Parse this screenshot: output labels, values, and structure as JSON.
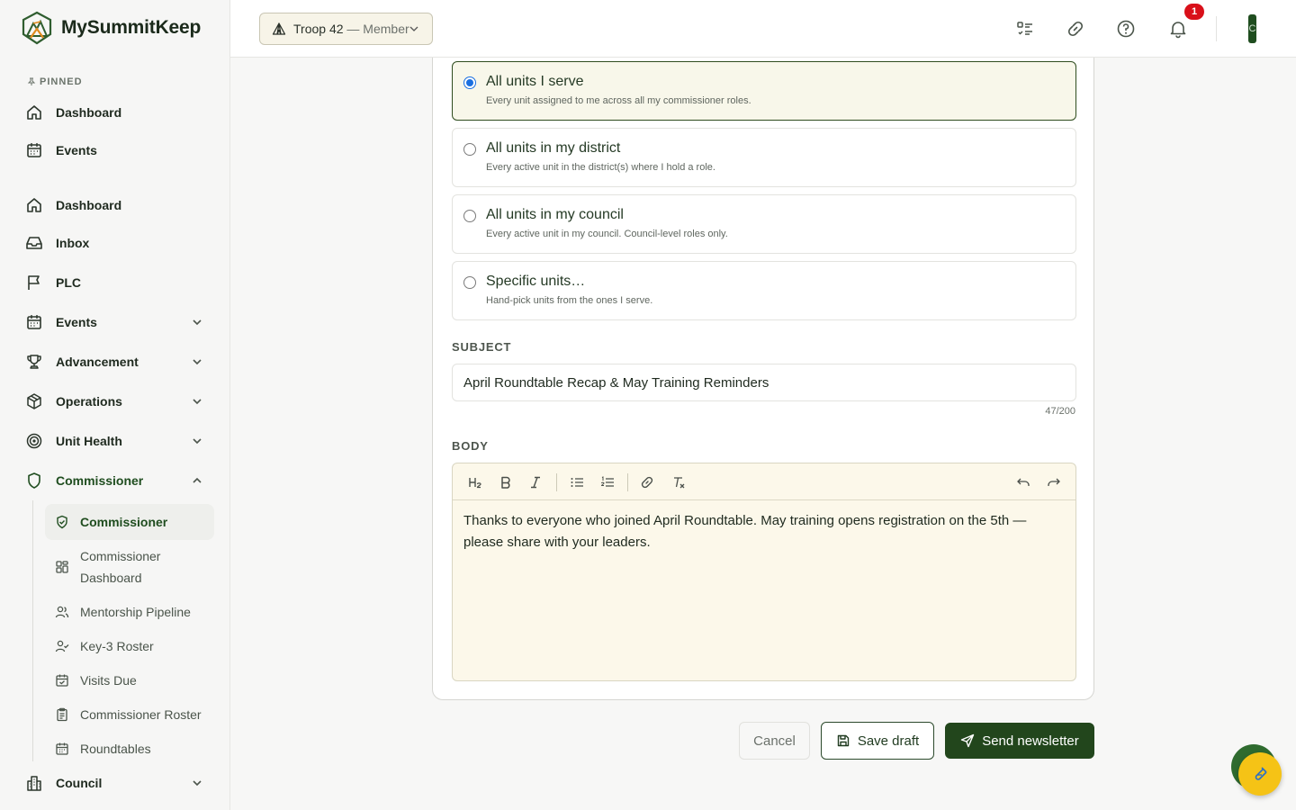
{
  "brand": {
    "name": "MySummitKeep"
  },
  "sidebar": {
    "pinned_label": "PINNED",
    "pinned": [
      {
        "label": "Dashboard"
      },
      {
        "label": "Events"
      }
    ],
    "nav": [
      {
        "label": "Dashboard"
      },
      {
        "label": "Inbox"
      },
      {
        "label": "PLC"
      },
      {
        "label": "Events"
      },
      {
        "label": "Advancement"
      },
      {
        "label": "Operations"
      },
      {
        "label": "Unit Health"
      },
      {
        "label": "Commissioner"
      },
      {
        "label": "Council"
      }
    ],
    "commissioner_sub": [
      {
        "label": "Commissioner"
      },
      {
        "label": "Commissioner Dashboard"
      },
      {
        "label": "Mentorship Pipeline"
      },
      {
        "label": "Key-3 Roster"
      },
      {
        "label": "Visits Due"
      },
      {
        "label": "Commissioner Roster"
      },
      {
        "label": "Roundtables"
      }
    ]
  },
  "topbar": {
    "unit": "Troop 42",
    "role": "— Member",
    "notification_count": "1",
    "avatar_initial": "C"
  },
  "audience": {
    "options": [
      {
        "title": "All units I serve",
        "desc": "Every unit assigned to me across all my commissioner roles.",
        "selected": true
      },
      {
        "title": "All units in my district",
        "desc": "Every active unit in the district(s) where I hold a role.",
        "selected": false
      },
      {
        "title": "All units in my council",
        "desc": "Every active unit in my council. Council-level roles only.",
        "selected": false
      },
      {
        "title": "Specific units…",
        "desc": "Hand-pick units from the ones I serve.",
        "selected": false
      }
    ]
  },
  "subject": {
    "label": "SUBJECT",
    "value": "April Roundtable Recap & May Training Reminders",
    "count": "47/200"
  },
  "body": {
    "label": "BODY",
    "text": "Thanks to everyone who joined April Roundtable. May training opens registration on the 5th — please share with your leaders."
  },
  "actions": {
    "cancel": "Cancel",
    "save_draft": "Save draft",
    "send": "Send newsletter"
  },
  "colors": {
    "brand_green": "#22461c",
    "accent_yellow": "#f5c316",
    "badge_red": "#d9101a"
  }
}
